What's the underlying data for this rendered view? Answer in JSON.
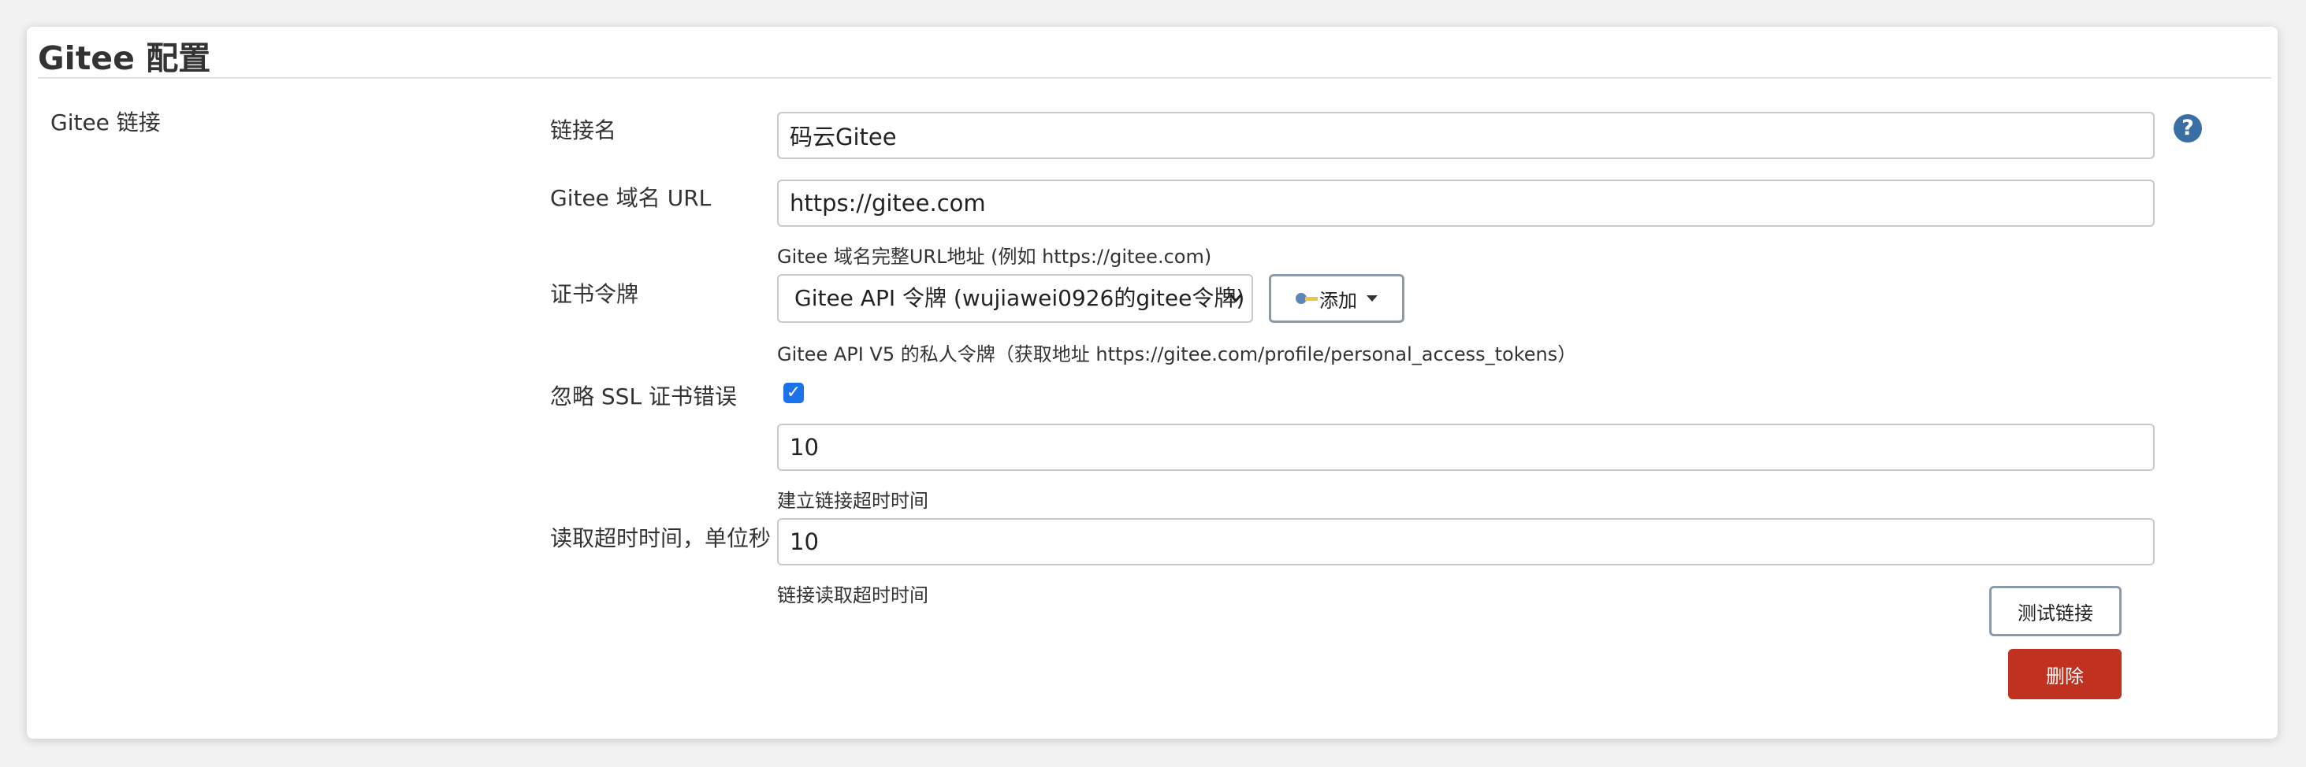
{
  "section": {
    "title": "Gitee 配置",
    "group_label": "Gitee 链接"
  },
  "fields": {
    "connection_name": {
      "label": "链接名",
      "value": "码云Gitee"
    },
    "domain_url": {
      "label": "Gitee 域名 URL",
      "value": "https://gitee.com",
      "help": "Gitee 域名完整URL地址 (例如 https://gitee.com)"
    },
    "credentials": {
      "label": "证书令牌",
      "selected": "Gitee API 令牌 (wujiawei0926的gitee令牌)",
      "add_label": "添加",
      "help": "Gitee API V5 的私人令牌（获取地址 https://gitee.com/profile/personal_access_tokens）"
    },
    "ignore_ssl": {
      "label": "忽略 SSL 证书错误",
      "checked": true,
      "check_glyph": "✓"
    },
    "connect_timeout": {
      "value": "10",
      "help": "建立链接超时时间"
    },
    "read_timeout": {
      "label": "读取超时时间，单位秒",
      "value": "10",
      "help": "链接读取超时时间"
    }
  },
  "help_icon": {
    "name": "question-circle-icon",
    "glyph": "?"
  },
  "buttons": {
    "test_label": "测试链接",
    "delete_label": "删除"
  },
  "colors": {
    "help_icon": "#3a6fa5",
    "checkbox": "#1a73e8",
    "delete_button": "#c0311f"
  }
}
